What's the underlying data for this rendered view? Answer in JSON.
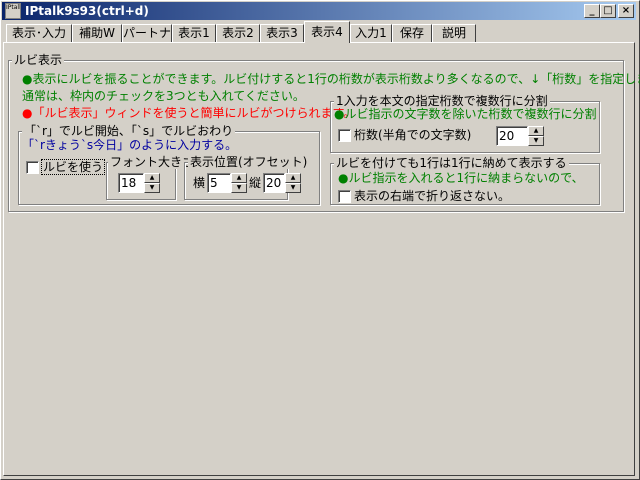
{
  "window": {
    "title": "IPtalk9s93(ctrl+d)",
    "icon_text": "IPtalk",
    "minimize": "_",
    "maximize": "□",
    "close": "×"
  },
  "tabs": [
    {
      "label": "表示･入力"
    },
    {
      "label": "補助W"
    },
    {
      "label": "パートナー"
    },
    {
      "label": "表示1"
    },
    {
      "label": "表示2"
    },
    {
      "label": "表示3"
    },
    {
      "label": "表示4",
      "active": true
    },
    {
      "label": "入力1"
    },
    {
      "label": "保存"
    },
    {
      "label": "説明"
    }
  ],
  "ruby": {
    "title": "ルビ表示",
    "desc1": "●表示にルビを振ることができます。ルビ付けすると1行の桁数が表示桁数より多くなるので、↓「桁数」を指定します。",
    "desc2": "通常は、枠内のチェックを3つとも入れてください。",
    "desc3": "●「ルビ表示」ウィンドを使うと簡単にルビがつけられます。",
    "markers": {
      "title": "「`r」でルビ開始、「`s」でルビおわり",
      "example": "「`rきょう`s今日」のように入力する。",
      "use_ruby_label": "ルビを使う",
      "use_ruby_checked": false,
      "font_size_title": "フォント大きさ",
      "font_size_value": "18",
      "position_title": "表示位置(オフセット)",
      "x_label": "横",
      "x_value": "5",
      "y_label": "縦",
      "y_value": "20"
    },
    "split": {
      "title": "1入力を本文の指定桁数で複数行に分割",
      "desc": "●ルビ指示の文字数を除いた桁数で複数行に分割",
      "digits_label": "桁数(半角での文字数)",
      "digits_checked": false,
      "digits_value": "20"
    },
    "fit": {
      "title": "ルビを付けても1行は1行に納めて表示する",
      "desc": "●ルビ指示を入れると1行に納まらないので、",
      "wrap_label": "表示の右端で折り返さない。",
      "wrap_checked": false
    }
  },
  "colors": {
    "green": "#008000",
    "red": "#ff0000",
    "blue": "#0000a0",
    "title_bar": "#0a246a",
    "face": "#d4d0c8"
  }
}
